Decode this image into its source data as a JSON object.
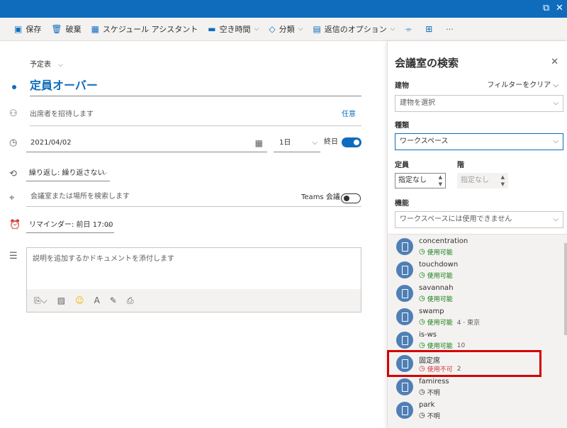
{
  "toolbar": {
    "save": "保存",
    "discard": "破棄",
    "scheduling": "スケジュール アシスタント",
    "busy": "空き時間",
    "categorize": "分類",
    "response": "返信のオプション",
    "more": "···"
  },
  "form": {
    "calendar": "予定表",
    "title": "定員オーバー",
    "attendees_placeholder": "出席者を招待します",
    "optional": "任意",
    "date": "2021/04/02",
    "duration": "1日",
    "all_day": "終日",
    "all_day_on": true,
    "recurrence": "繰り返し: 繰り返さない",
    "location_placeholder": "会議室または場所を検索します",
    "teams": "Teams 会議",
    "teams_on": false,
    "reminder": "リマインダー: 前日 17:00",
    "description_placeholder": "説明を追加するかドキュメントを添付します"
  },
  "panel": {
    "title": "会議室の検索",
    "building_label": "建物",
    "clear_filter": "フィルターをクリア",
    "building_placeholder": "建物を選択",
    "type_label": "種類",
    "type_value": "ワークスペース",
    "capacity_label": "定員",
    "capacity_value": "指定なし",
    "floor_label": "階",
    "floor_value": "指定なし",
    "features_label": "機能",
    "features_value": "ワークスペースには使用できません",
    "rooms": [
      {
        "name": "concentration",
        "status": "使用可能",
        "state": "avail",
        "meta": ""
      },
      {
        "name": "touchdown",
        "status": "使用可能",
        "state": "avail",
        "meta": ""
      },
      {
        "name": "savannah",
        "status": "使用可能",
        "state": "avail",
        "meta": ""
      },
      {
        "name": "swamp",
        "status": "使用可能",
        "state": "avail",
        "meta": "4 · 東京"
      },
      {
        "name": "is-ws",
        "status": "使用可能",
        "state": "avail",
        "meta": "10"
      },
      {
        "name": "固定席",
        "status": "使用不可",
        "state": "busy",
        "meta": "2"
      },
      {
        "name": "famiress",
        "status": "不明",
        "state": "unknown",
        "meta": ""
      },
      {
        "name": "park",
        "status": "不明",
        "state": "unknown",
        "meta": ""
      }
    ]
  }
}
